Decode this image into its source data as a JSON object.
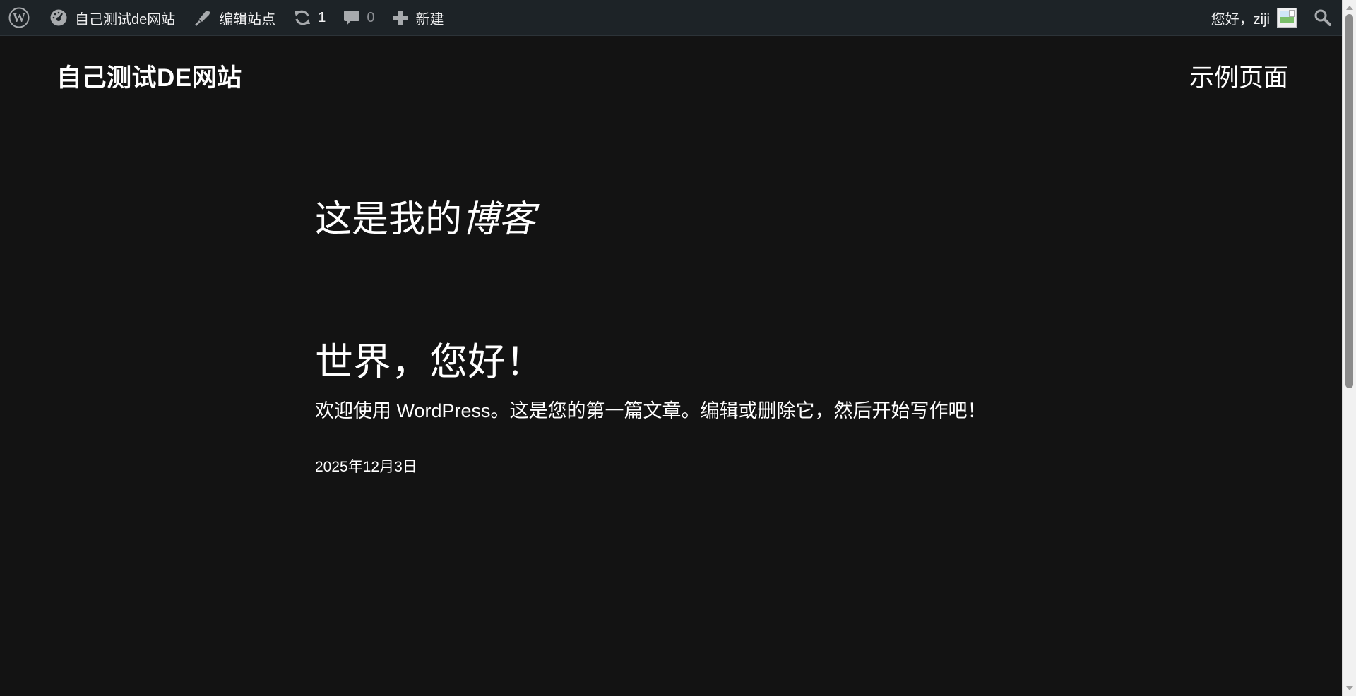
{
  "adminbar": {
    "site_name": "自己测试de网站",
    "edit_site": "编辑站点",
    "updates_count": "1",
    "comments_count": "0",
    "new_label": "新建",
    "greeting": "您好，ziji",
    "icons": {
      "wp": "wordpress-logo-icon",
      "dashboard": "dashboard-icon",
      "edit": "brush-icon",
      "updates": "refresh-icon",
      "comments": "comment-bubble-icon",
      "new": "plus-icon",
      "avatar": "avatar-image-icon",
      "search": "search-icon"
    }
  },
  "site": {
    "title": "自己测试DE网站",
    "nav": [
      "示例页面"
    ]
  },
  "main": {
    "heading_plain": "这是我的",
    "heading_em": "博客",
    "post": {
      "title": "世界，您好！",
      "excerpt": "欢迎使用 WordPress。这是您的第一篇文章。编辑或删除它，然后开始写作吧！",
      "date": "2025年12月3日"
    }
  },
  "colors": {
    "page_bg": "#131313",
    "adminbar_bg": "#1d2327",
    "text": "#ffffff"
  }
}
